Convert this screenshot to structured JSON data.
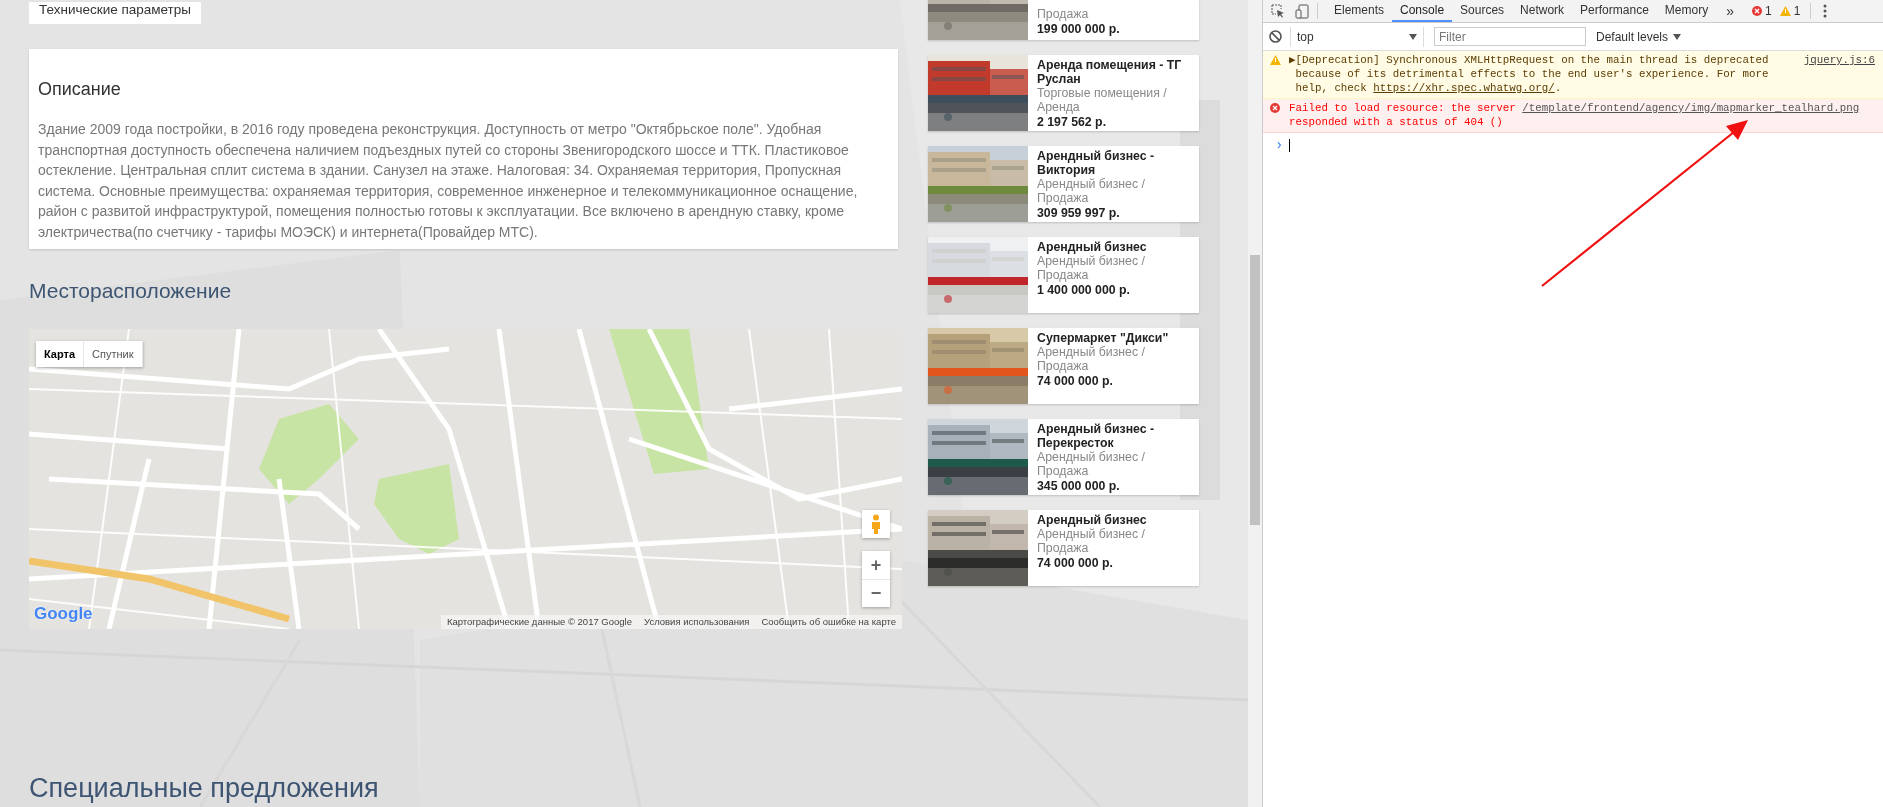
{
  "page": {
    "tab_label": "Технические параметры",
    "description": {
      "title": "Описание",
      "text": "Здание 2009 года постройки, в 2016 году проведена реконструкция. Доступность от метро \"Октябрьское поле\". Удобная транспортная доступность обеспечена наличием подъездных путей со стороны Звенигородского шоссе и ТТК. Пластиковое остекление. Центральная сплит система в здании. Санузел на этаже. Налоговая: 34. Охраняемая территория, Пропускная система. Основные преимущества: охраняемая территория, современное инженерное и телекоммуникационное оснащение, район с развитой инфраструктурой, помещения полностью готовы к эксплуатации. Все включено в арендную ставку, кроме электричества(по счетчику - тарифы МОЭСК) и интернета(Провайдер МТС)."
    },
    "location_title": "Месторасположение",
    "map": {
      "map_types": [
        {
          "label": "Карта",
          "selected": true
        },
        {
          "label": "Спутник",
          "selected": false
        }
      ],
      "zoom_in": "+",
      "zoom_out": "−",
      "logo": "Google",
      "attribution": [
        "Картографические данные © 2017 Google",
        "Условия использования",
        "Сообщить об ошибке на карте"
      ]
    },
    "special_title": "Специальные предложения"
  },
  "listings": [
    {
      "category": "Продажа",
      "price": "199 000 000 р."
    },
    {
      "title": "Аренда помещения - ТГ Руслан",
      "category": "Торговые помещения / Аренда",
      "price": "2 197 562 р."
    },
    {
      "title": "Арендный бизнес - Виктория",
      "category": "Арендный бизнес / Продажа",
      "price": "309 959 997 р."
    },
    {
      "title": "Арендный бизнес",
      "category": "Арендный бизнес / Продажа",
      "price": "1 400 000 000 р."
    },
    {
      "title": "Супермаркет \"Дикси\"",
      "category": "Арендный бизнес / Продажа",
      "price": "74 000 000 р."
    },
    {
      "title": "Арендный бизнес - Перекресток",
      "category": "Арендный бизнес / Продажа",
      "price": "345 000 000 р."
    },
    {
      "title": "Арендный бизнес",
      "category": "Арендный бизнес / Продажа",
      "price": "74 000 000 р."
    }
  ],
  "devtools": {
    "tabs": [
      {
        "label": "Elements",
        "selected": false
      },
      {
        "label": "Console",
        "selected": true
      },
      {
        "label": "Sources",
        "selected": false
      },
      {
        "label": "Network",
        "selected": false
      },
      {
        "label": "Performance",
        "selected": false
      },
      {
        "label": "Memory",
        "selected": false
      }
    ],
    "more": "»",
    "error_count": "1",
    "warning_count": "1",
    "context": "top",
    "filter_placeholder": "Filter",
    "levels": "Default levels",
    "messages": [
      {
        "kind": "warning",
        "expander": "▶",
        "text": "[Deprecation] Synchronous XMLHttpRequest on the main thread is deprecated because of its detrimental effects to the end user's experience. For more help, check ",
        "link": "https://xhr.spec.whatwg.org/",
        "after": ".",
        "source": "jquery.js:6"
      },
      {
        "kind": "error",
        "text": "Failed to load resource: the server ",
        "link": "/template/frontend/agency/img/mapmarker_tealhard.png",
        "after": " responded with a status of 404 ()"
      }
    ],
    "prompt": "›"
  }
}
